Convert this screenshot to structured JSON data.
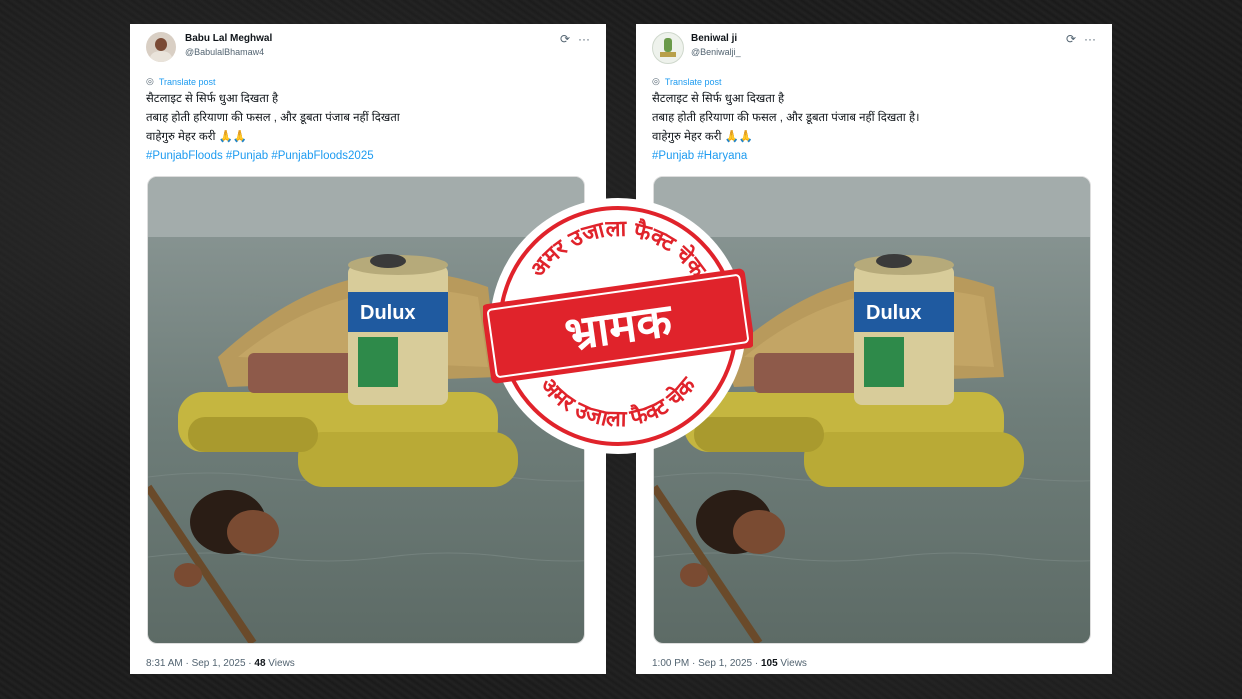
{
  "posts": [
    {
      "author_name": "Babu Lal Meghwal",
      "author_handle": "@BabulalBhamaw4",
      "translate_label": "Translate post",
      "lines": [
        "सैटलाइट से सिर्फ धुआ दिखता है",
        "तबाह होती हरियाणा की फसल , और डूबता पंजाब नहीं दिखता",
        "वाहेगुरु मेहर करी 🙏🙏"
      ],
      "hashtags": "#PunjabFloods #Punjab #PunjabFloods2025",
      "time": "8:31 AM · Sep 1, 2025 · ",
      "views": "48",
      "views_label": " Views"
    },
    {
      "author_name": "Beniwal ji",
      "author_handle": "@Beniwalji_",
      "translate_label": "Translate post",
      "lines": [
        "सैटलाइट से सिर्फ धुआ दिखता है",
        "तबाह होती हरियाणा की फसल , और डूबता पंजाब नहीं दिखता है।",
        "वाहेगुरु मेहर करी 🙏🙏"
      ],
      "hashtags": "#Punjab #Haryana",
      "time": "1:00 PM · Sep 1, 2025 · ",
      "views": "105",
      "views_label": " Views"
    }
  ],
  "stamp": {
    "verdict": "भ्रामक",
    "ring_text": "अमर उजाला फैक्ट चेक",
    "color": "#e0232b"
  },
  "photo": {
    "can_brand": "Dulux"
  },
  "icons": {
    "grok": "grok-icon",
    "more": "more-icon",
    "translate": "globe-icon"
  }
}
